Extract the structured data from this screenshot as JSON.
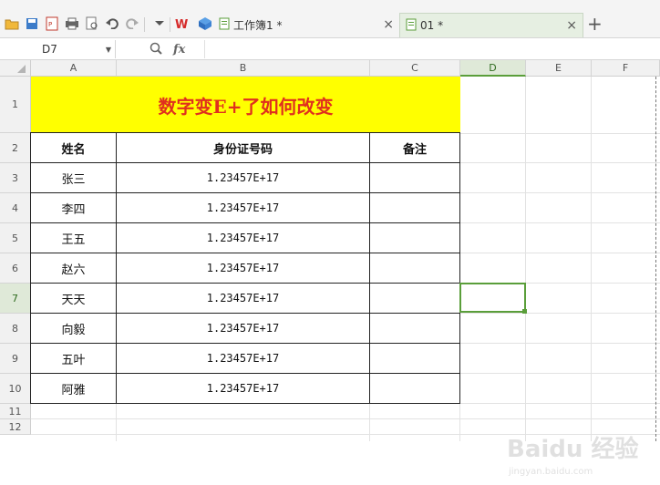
{
  "tabs": [
    {
      "label": "工作簿1 *",
      "close": "×"
    },
    {
      "label": "01 *",
      "close": "×"
    }
  ],
  "new_tab_glyph": "+",
  "namebox": {
    "value": "D7"
  },
  "formula": {
    "fx": "fx",
    "value": ""
  },
  "columns": [
    "A",
    "B",
    "C",
    "D",
    "E",
    "F"
  ],
  "selected_column": "D",
  "rows": [
    "1",
    "2",
    "3",
    "4",
    "5",
    "6",
    "7",
    "8",
    "9",
    "10",
    "11",
    "12"
  ],
  "selected_row": "7",
  "sheet": {
    "title": "数字变E+了如何改变",
    "headers": [
      "姓名",
      "身份证号码",
      "备注"
    ],
    "data": [
      {
        "name": "张三",
        "id": "1.23457E+17",
        "note": ""
      },
      {
        "name": "李四",
        "id": "1.23457E+17",
        "note": ""
      },
      {
        "name": "王五",
        "id": "1.23457E+17",
        "note": ""
      },
      {
        "name": "赵六",
        "id": "1.23457E+17",
        "note": ""
      },
      {
        "name": "天天",
        "id": "1.23457E+17",
        "note": ""
      },
      {
        "name": "向毅",
        "id": "1.23457E+17",
        "note": ""
      },
      {
        "name": "五叶",
        "id": "1.23457E+17",
        "note": ""
      },
      {
        "name": "阿雅",
        "id": "1.23457E+17",
        "note": ""
      }
    ]
  },
  "colors": {
    "title_bg": "#ffff00",
    "title_text": "#e0301e",
    "selection": "#5a9e3a"
  },
  "watermark": {
    "big": "Baidu 经验",
    "small": "jingyan.baidu.com"
  }
}
